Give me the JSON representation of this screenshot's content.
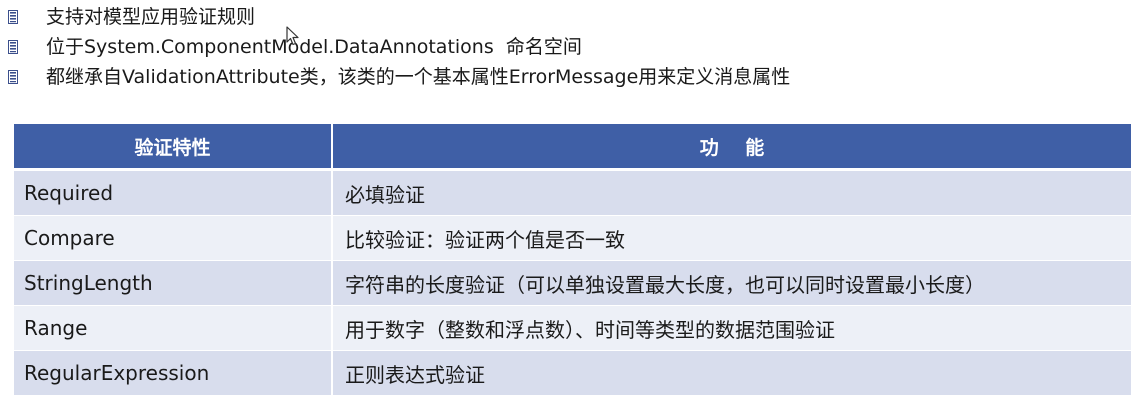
{
  "bullets": [
    {
      "text": "支持对模型应用验证规则",
      "icon": "bullet-icon"
    },
    {
      "text": "位于System.ComponentModel.DataAnnotations  命名空间",
      "icon": "bullet-icon"
    },
    {
      "text": "都继承自ValidationAttribute类，该类的一个基本属性ErrorMessage用来定义消息属性",
      "icon": "bullet-icon"
    }
  ],
  "table": {
    "headers": [
      "验证特性",
      "功    能"
    ],
    "rows": [
      {
        "attribute": "Required",
        "function": "必填验证"
      },
      {
        "attribute": "Compare",
        "function": "比较验证：验证两个值是否一致"
      },
      {
        "attribute": "StringLength",
        "function": "字符串的长度验证（可以单独设置最大长度，也可以同时设置最小长度）"
      },
      {
        "attribute": "Range",
        "function": "用于数字（整数和浮点数）、时间等类型的数据范围验证"
      },
      {
        "attribute": "RegularExpression",
        "function": "正则表达式验证"
      }
    ]
  },
  "colors": {
    "header_bg": "#3f5fa6",
    "row_odd": "#d8dded",
    "row_even": "#edf0f7",
    "bullet": "#3b4f8c"
  }
}
